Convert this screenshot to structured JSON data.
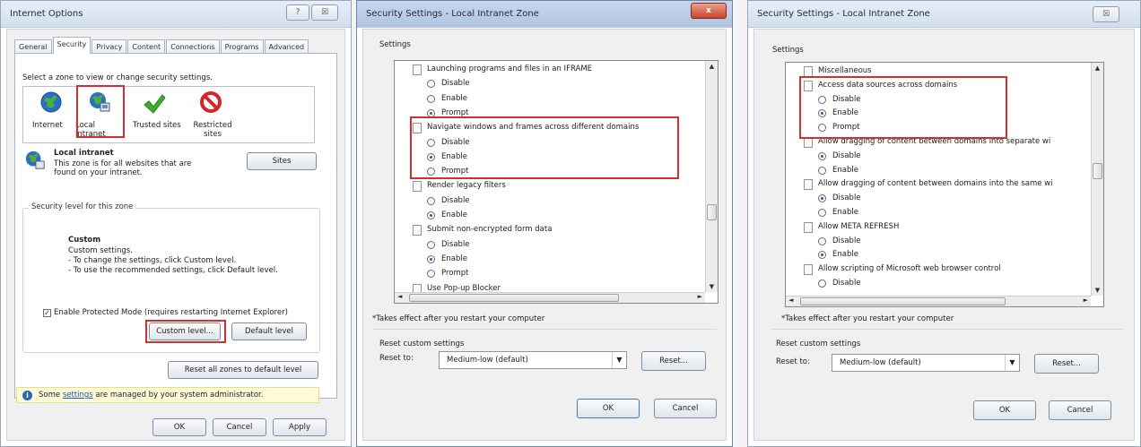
{
  "p1": {
    "title": "Internet Options",
    "help_btn": "?",
    "close_btn": "☒",
    "tabs": [
      "General",
      "Security",
      "Privacy",
      "Content",
      "Connections",
      "Programs",
      "Advanced"
    ],
    "instruction": "Select a zone to view or change security settings.",
    "zones": [
      {
        "label": "Internet"
      },
      {
        "label": "Local intranet"
      },
      {
        "label": "Trusted sites"
      },
      {
        "label": "Restricted sites"
      }
    ],
    "zone_title": "Local intranet",
    "zone_desc_1": "This zone is for all websites that are",
    "zone_desc_2": "found on your intranet.",
    "sites_btn": "Sites",
    "level_legend": "Security level for this zone",
    "level_name": "Custom",
    "level_l1": "Custom settings.",
    "level_l2": "- To change the settings, click Custom level.",
    "level_l3": "- To use the recommended settings, click Default level.",
    "protected_mode": "Enable Protected Mode (requires restarting Internet Explorer)",
    "custom_level_btn": "Custom level...",
    "default_level_btn": "Default level",
    "reset_all_btn": "Reset all zones to default level",
    "info_pre": "Some ",
    "info_link": "settings",
    "info_post": " are managed by your system administrator.",
    "ok": "OK",
    "cancel": "Cancel",
    "apply": "Apply"
  },
  "p2": {
    "title": "Security Settings - Local Intranet Zone",
    "close_btn": "x",
    "settings_label": "Settings",
    "items": [
      {
        "type": "group",
        "text": "Launching programs and files in an IFRAME"
      },
      {
        "type": "radio",
        "text": "Disable",
        "on": false
      },
      {
        "type": "radio",
        "text": "Enable",
        "on": false
      },
      {
        "type": "radio",
        "text": "Prompt",
        "on": true
      },
      {
        "type": "group",
        "text": "Navigate windows and frames across different domains"
      },
      {
        "type": "radio",
        "text": "Disable",
        "on": false
      },
      {
        "type": "radio",
        "text": "Enable",
        "on": true
      },
      {
        "type": "radio",
        "text": "Prompt",
        "on": false
      },
      {
        "type": "group",
        "text": "Render legacy filters"
      },
      {
        "type": "radio",
        "text": "Disable",
        "on": false
      },
      {
        "type": "radio",
        "text": "Enable",
        "on": true
      },
      {
        "type": "group",
        "text": "Submit non-encrypted form data"
      },
      {
        "type": "radio",
        "text": "Disable",
        "on": false
      },
      {
        "type": "radio",
        "text": "Enable",
        "on": true
      },
      {
        "type": "radio",
        "text": "Prompt",
        "on": false
      },
      {
        "type": "group",
        "text": "Use Pop-up Blocker"
      }
    ],
    "note": "*Takes effect after you restart your computer",
    "reset_legend": "Reset custom settings",
    "reset_to": "Reset to:",
    "reset_value": "Medium-low (default)",
    "reset_btn": "Reset...",
    "ok": "OK",
    "cancel": "Cancel"
  },
  "p3": {
    "title": "Security Settings - Local Intranet Zone",
    "close_btn": "☒",
    "settings_label": "Settings",
    "items": [
      {
        "type": "group",
        "text": "Miscellaneous"
      },
      {
        "type": "group",
        "text": "Access data sources across domains"
      },
      {
        "type": "radio",
        "text": "Disable",
        "on": false
      },
      {
        "type": "radio",
        "text": "Enable",
        "on": true
      },
      {
        "type": "radio",
        "text": "Prompt",
        "on": false
      },
      {
        "type": "group",
        "text": "Allow dragging of content between domains into separate wi"
      },
      {
        "type": "radio",
        "text": "Disable",
        "on": true
      },
      {
        "type": "radio",
        "text": "Enable",
        "on": false
      },
      {
        "type": "group",
        "text": "Allow dragging of content between domains into the same wi"
      },
      {
        "type": "radio",
        "text": "Disable",
        "on": true
      },
      {
        "type": "radio",
        "text": "Enable",
        "on": false
      },
      {
        "type": "group",
        "text": "Allow META REFRESH"
      },
      {
        "type": "radio",
        "text": "Disable",
        "on": false
      },
      {
        "type": "radio",
        "text": "Enable",
        "on": true
      },
      {
        "type": "group",
        "text": "Allow scripting of Microsoft web browser control"
      },
      {
        "type": "radio",
        "text": "Disable",
        "on": false
      }
    ],
    "note": "*Takes effect after you restart your computer",
    "reset_legend": "Reset custom settings",
    "reset_to": "Reset to:",
    "reset_value": "Medium-low (default)",
    "reset_btn": "Reset...",
    "ok": "OK",
    "cancel": "Cancel"
  },
  "colors": {
    "highlight": "#d23030",
    "title_bg": "#dde6f1"
  }
}
